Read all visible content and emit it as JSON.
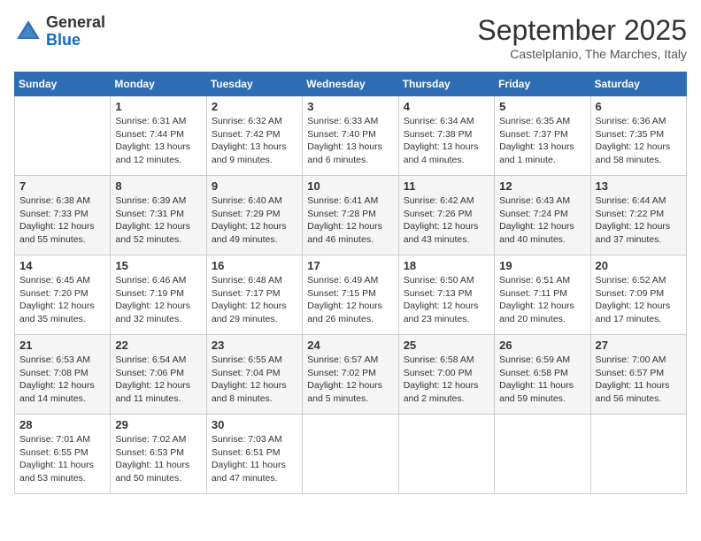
{
  "header": {
    "logo_general": "General",
    "logo_blue": "Blue",
    "month_title": "September 2025",
    "subtitle": "Castelplanio, The Marches, Italy"
  },
  "weekdays": [
    "Sunday",
    "Monday",
    "Tuesday",
    "Wednesday",
    "Thursday",
    "Friday",
    "Saturday"
  ],
  "weeks": [
    [
      {
        "day": "",
        "sunrise": "",
        "sunset": "",
        "daylight": ""
      },
      {
        "day": "1",
        "sunrise": "Sunrise: 6:31 AM",
        "sunset": "Sunset: 7:44 PM",
        "daylight": "Daylight: 13 hours and 12 minutes."
      },
      {
        "day": "2",
        "sunrise": "Sunrise: 6:32 AM",
        "sunset": "Sunset: 7:42 PM",
        "daylight": "Daylight: 13 hours and 9 minutes."
      },
      {
        "day": "3",
        "sunrise": "Sunrise: 6:33 AM",
        "sunset": "Sunset: 7:40 PM",
        "daylight": "Daylight: 13 hours and 6 minutes."
      },
      {
        "day": "4",
        "sunrise": "Sunrise: 6:34 AM",
        "sunset": "Sunset: 7:38 PM",
        "daylight": "Daylight: 13 hours and 4 minutes."
      },
      {
        "day": "5",
        "sunrise": "Sunrise: 6:35 AM",
        "sunset": "Sunset: 7:37 PM",
        "daylight": "Daylight: 13 hours and 1 minute."
      },
      {
        "day": "6",
        "sunrise": "Sunrise: 6:36 AM",
        "sunset": "Sunset: 7:35 PM",
        "daylight": "Daylight: 12 hours and 58 minutes."
      }
    ],
    [
      {
        "day": "7",
        "sunrise": "Sunrise: 6:38 AM",
        "sunset": "Sunset: 7:33 PM",
        "daylight": "Daylight: 12 hours and 55 minutes."
      },
      {
        "day": "8",
        "sunrise": "Sunrise: 6:39 AM",
        "sunset": "Sunset: 7:31 PM",
        "daylight": "Daylight: 12 hours and 52 minutes."
      },
      {
        "day": "9",
        "sunrise": "Sunrise: 6:40 AM",
        "sunset": "Sunset: 7:29 PM",
        "daylight": "Daylight: 12 hours and 49 minutes."
      },
      {
        "day": "10",
        "sunrise": "Sunrise: 6:41 AM",
        "sunset": "Sunset: 7:28 PM",
        "daylight": "Daylight: 12 hours and 46 minutes."
      },
      {
        "day": "11",
        "sunrise": "Sunrise: 6:42 AM",
        "sunset": "Sunset: 7:26 PM",
        "daylight": "Daylight: 12 hours and 43 minutes."
      },
      {
        "day": "12",
        "sunrise": "Sunrise: 6:43 AM",
        "sunset": "Sunset: 7:24 PM",
        "daylight": "Daylight: 12 hours and 40 minutes."
      },
      {
        "day": "13",
        "sunrise": "Sunrise: 6:44 AM",
        "sunset": "Sunset: 7:22 PM",
        "daylight": "Daylight: 12 hours and 37 minutes."
      }
    ],
    [
      {
        "day": "14",
        "sunrise": "Sunrise: 6:45 AM",
        "sunset": "Sunset: 7:20 PM",
        "daylight": "Daylight: 12 hours and 35 minutes."
      },
      {
        "day": "15",
        "sunrise": "Sunrise: 6:46 AM",
        "sunset": "Sunset: 7:19 PM",
        "daylight": "Daylight: 12 hours and 32 minutes."
      },
      {
        "day": "16",
        "sunrise": "Sunrise: 6:48 AM",
        "sunset": "Sunset: 7:17 PM",
        "daylight": "Daylight: 12 hours and 29 minutes."
      },
      {
        "day": "17",
        "sunrise": "Sunrise: 6:49 AM",
        "sunset": "Sunset: 7:15 PM",
        "daylight": "Daylight: 12 hours and 26 minutes."
      },
      {
        "day": "18",
        "sunrise": "Sunrise: 6:50 AM",
        "sunset": "Sunset: 7:13 PM",
        "daylight": "Daylight: 12 hours and 23 minutes."
      },
      {
        "day": "19",
        "sunrise": "Sunrise: 6:51 AM",
        "sunset": "Sunset: 7:11 PM",
        "daylight": "Daylight: 12 hours and 20 minutes."
      },
      {
        "day": "20",
        "sunrise": "Sunrise: 6:52 AM",
        "sunset": "Sunset: 7:09 PM",
        "daylight": "Daylight: 12 hours and 17 minutes."
      }
    ],
    [
      {
        "day": "21",
        "sunrise": "Sunrise: 6:53 AM",
        "sunset": "Sunset: 7:08 PM",
        "daylight": "Daylight: 12 hours and 14 minutes."
      },
      {
        "day": "22",
        "sunrise": "Sunrise: 6:54 AM",
        "sunset": "Sunset: 7:06 PM",
        "daylight": "Daylight: 12 hours and 11 minutes."
      },
      {
        "day": "23",
        "sunrise": "Sunrise: 6:55 AM",
        "sunset": "Sunset: 7:04 PM",
        "daylight": "Daylight: 12 hours and 8 minutes."
      },
      {
        "day": "24",
        "sunrise": "Sunrise: 6:57 AM",
        "sunset": "Sunset: 7:02 PM",
        "daylight": "Daylight: 12 hours and 5 minutes."
      },
      {
        "day": "25",
        "sunrise": "Sunrise: 6:58 AM",
        "sunset": "Sunset: 7:00 PM",
        "daylight": "Daylight: 12 hours and 2 minutes."
      },
      {
        "day": "26",
        "sunrise": "Sunrise: 6:59 AM",
        "sunset": "Sunset: 6:58 PM",
        "daylight": "Daylight: 11 hours and 59 minutes."
      },
      {
        "day": "27",
        "sunrise": "Sunrise: 7:00 AM",
        "sunset": "Sunset: 6:57 PM",
        "daylight": "Daylight: 11 hours and 56 minutes."
      }
    ],
    [
      {
        "day": "28",
        "sunrise": "Sunrise: 7:01 AM",
        "sunset": "Sunset: 6:55 PM",
        "daylight": "Daylight: 11 hours and 53 minutes."
      },
      {
        "day": "29",
        "sunrise": "Sunrise: 7:02 AM",
        "sunset": "Sunset: 6:53 PM",
        "daylight": "Daylight: 11 hours and 50 minutes."
      },
      {
        "day": "30",
        "sunrise": "Sunrise: 7:03 AM",
        "sunset": "Sunset: 6:51 PM",
        "daylight": "Daylight: 11 hours and 47 minutes."
      },
      {
        "day": "",
        "sunrise": "",
        "sunset": "",
        "daylight": ""
      },
      {
        "day": "",
        "sunrise": "",
        "sunset": "",
        "daylight": ""
      },
      {
        "day": "",
        "sunrise": "",
        "sunset": "",
        "daylight": ""
      },
      {
        "day": "",
        "sunrise": "",
        "sunset": "",
        "daylight": ""
      }
    ]
  ]
}
